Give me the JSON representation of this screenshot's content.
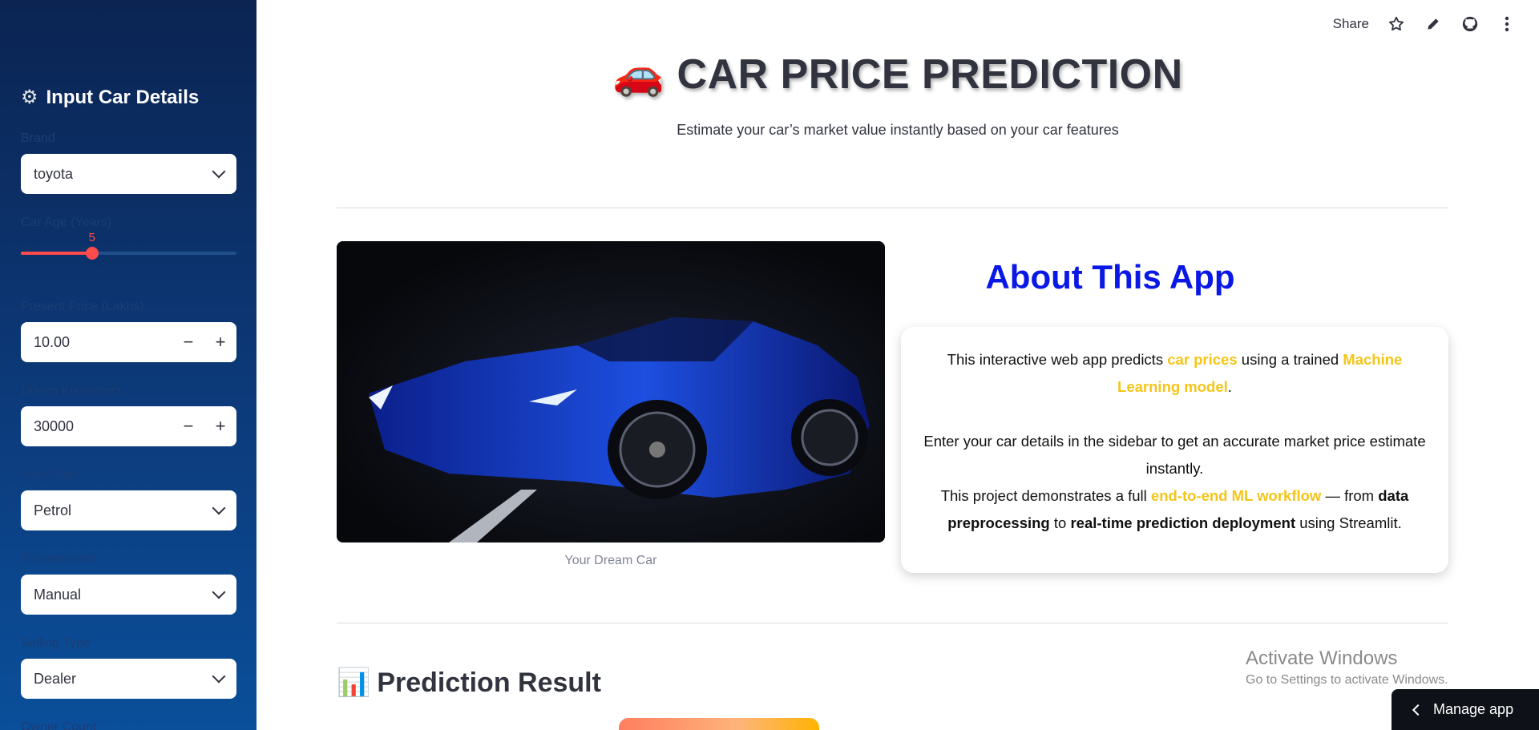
{
  "sidebar": {
    "header": "Input Car Details",
    "brand": {
      "label": "Brand",
      "value": "toyota"
    },
    "car_age": {
      "label": "Car Age (Years)",
      "value": "5",
      "fraction": 0.33
    },
    "present_price": {
      "label": "Present Price (Lakhs)",
      "value": "10.00",
      "minus": "−",
      "plus": "+"
    },
    "kms": {
      "label": "Driven Kilometers",
      "value": "30000",
      "minus": "−",
      "plus": "+"
    },
    "fuel": {
      "label": "Fuel Type",
      "value": "Petrol"
    },
    "transmission": {
      "label": "Transmission",
      "value": "Manual"
    },
    "selling": {
      "label": "Selling Type",
      "value": "Dealer"
    },
    "owner": {
      "label": "Owner Count"
    }
  },
  "topbar": {
    "share": "Share"
  },
  "main": {
    "title_emoji": "🚗",
    "title": "CAR PRICE PREDICTION",
    "subtitle": "Estimate your car’s market value instantly based on your car features",
    "image_caption": "Your Dream Car",
    "about_title": "About This App",
    "about": {
      "p1_a": "This interactive web app predicts ",
      "p1_hl1": "car prices",
      "p1_b": " using a trained ",
      "p1_hl2": "Machine Learning model",
      "p1_c": ".",
      "p2": "Enter your car details in the sidebar to get an accurate market price estimate instantly.",
      "p3_a": "This project demonstrates a full ",
      "p3_hl": "end-to-end ML workflow",
      "p3_b": " — from ",
      "p3_bold1": "data preprocessing",
      "p3_c": " to ",
      "p3_bold2": "real-time prediction deployment",
      "p3_d": " using Streamlit."
    },
    "prediction_emoji": "📊",
    "prediction_title": "Prediction Result"
  },
  "overlay": {
    "watermark_title": "Activate Windows",
    "watermark_sub": "Go to Settings to activate Windows.",
    "manage_app": "Manage app"
  },
  "colors": {
    "accent": "#ff4b4b",
    "highlight": "#f5c518",
    "about_title": "#0a18e6"
  }
}
